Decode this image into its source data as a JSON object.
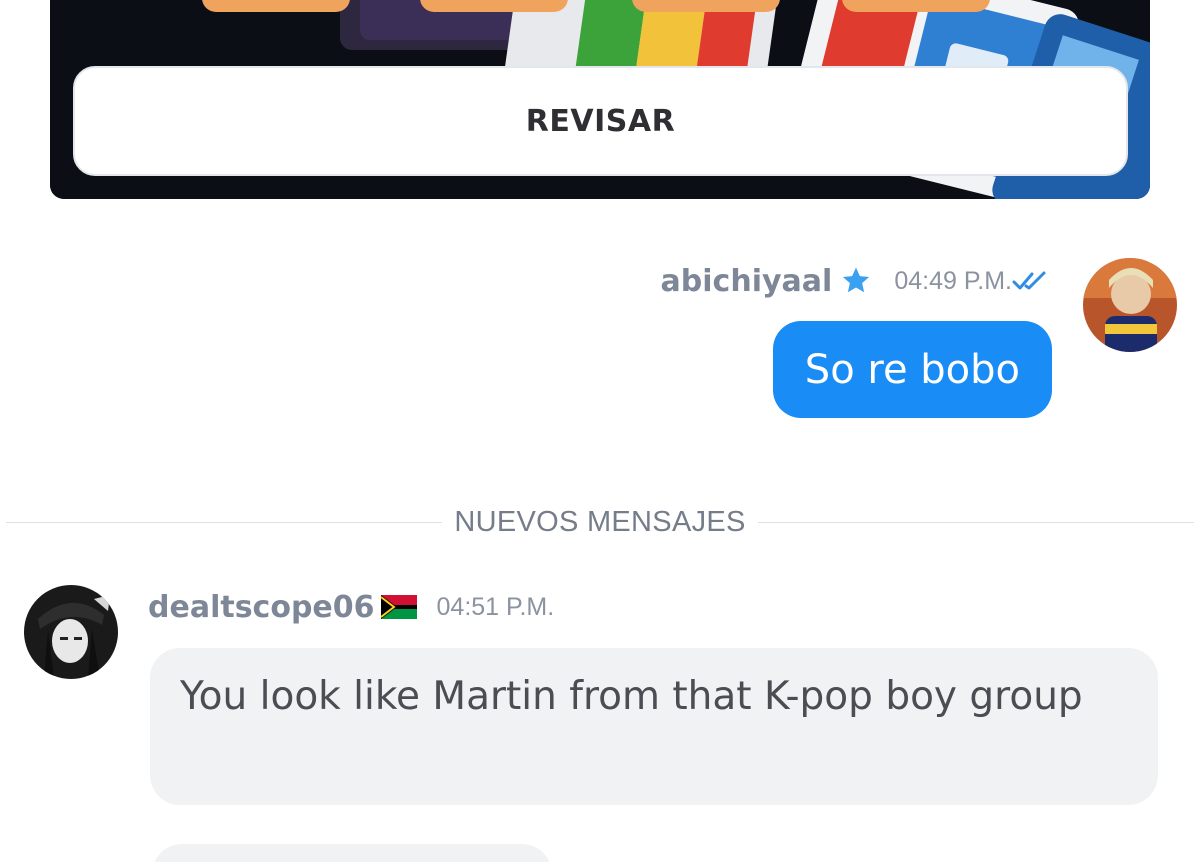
{
  "game_card": {
    "review_label": "REVISAR",
    "tile_color": "#f0a35c"
  },
  "outgoing_message": {
    "username": "abichiyaal",
    "badge_icon": "star-icon",
    "timestamp": "04:49 P.M.",
    "read_status_icon": "double-check-icon",
    "text": "So re bobo",
    "bubble_color": "#1a8cf5"
  },
  "divider": {
    "label": "NUEVOS MENSAJES"
  },
  "incoming_message": {
    "username": "dealtscope06",
    "flag_icon": "vanuatu-flag-icon",
    "timestamp": "04:51 P.M.",
    "text": "You look like Martin from that K-pop boy group",
    "bubble_color": "#f1f2f4"
  }
}
